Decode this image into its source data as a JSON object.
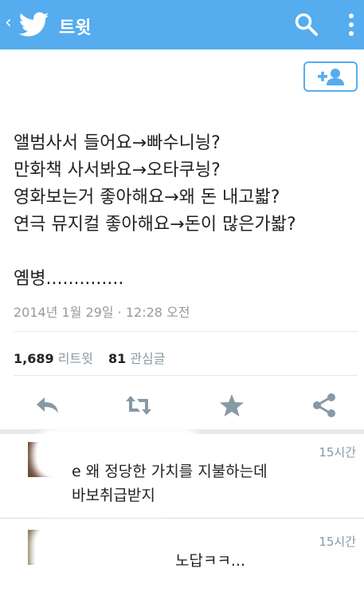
{
  "topbar": {
    "back_glyph": "‹",
    "logo_icon": "twitter-bird-icon",
    "title": "트윗",
    "search_icon": "search-icon",
    "more_icon": "vertical-dots-icon",
    "background": "#55acee"
  },
  "follow_button": {
    "icon": "add-user-icon",
    "color": "#55acee"
  },
  "tweet": {
    "text": "앨범사서 들어요→빠수니닁?\n만화책 사서봐요→오타쿠닁?\n영화보는거 좋아해요→왜 돈 내고봛?\n연극 뮤지컬 좋아해요→돈이 많은가봛?\n\n옘병..............",
    "timestamp": "2014년 1월 29일 · 12:28 오전",
    "retweets_count": "1,689",
    "retweets_label": "리트윗",
    "favorites_count": "81",
    "favorites_label": "관심글"
  },
  "actions": [
    {
      "name": "reply-icon"
    },
    {
      "name": "retweet-icon"
    },
    {
      "name": "favorite-star-icon"
    },
    {
      "name": "share-icon"
    }
  ],
  "replies": [
    {
      "time": "15시간",
      "text": "e 왜 정당한 가치를 지불하는데\n바보취급받지"
    },
    {
      "time": "15시간",
      "text": "노답ㅋㅋ..."
    }
  ]
}
